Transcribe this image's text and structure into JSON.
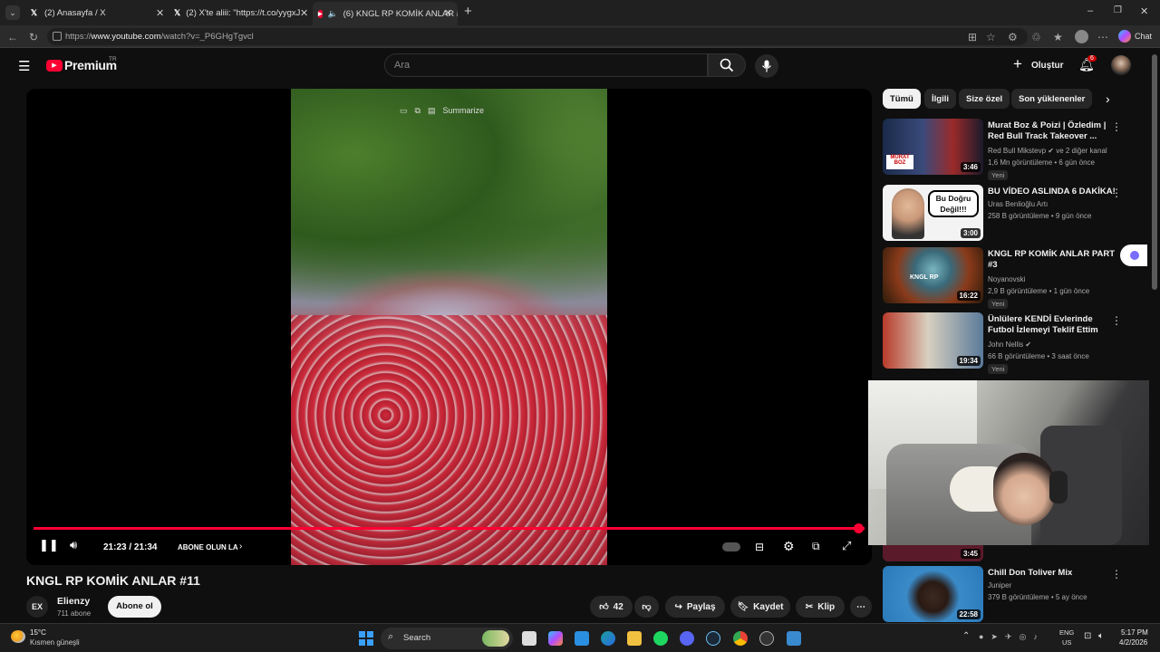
{
  "browser": {
    "tabs": [
      {
        "title": "(2) Anasayfa / X",
        "icon": "x-logo-icon"
      },
      {
        "title": "(2) X'te aliii: \"https://t.co/yygxJiKC",
        "icon": "x-logo-icon"
      },
      {
        "title": "(6) KNGL RP KOMİK ANLAR #",
        "icon": "youtube-icon"
      }
    ],
    "url_prefix": "https://",
    "url_domain": "www.youtube.com",
    "url_path": "/watch?v=_P6GHgTgvcl",
    "copilot_label": "Chat"
  },
  "youtube": {
    "logo_text": "Premium",
    "logo_region": "TR",
    "search_placeholder": "Ara",
    "create_label": "Oluştur",
    "notification_count": "6"
  },
  "player": {
    "overlay_label": "Summarize",
    "time": "21:23 / 21:34",
    "subscribe_cta": "ABONE OLUN LA",
    "progress": 1.0
  },
  "video": {
    "title": "KNGL RP KOMİK ANLAR #11",
    "channel": "Elienzy",
    "channel_avatar_text": "EX",
    "subscribers": "711 abone",
    "subscribe_button": "Abone ol",
    "likes": "42",
    "share_label": "Paylaş",
    "save_label": "Kaydet",
    "clip_label": "Klip"
  },
  "sidebar": {
    "chips": [
      "Tümü",
      "İlgili",
      "Size özel",
      "Son yüklenenler"
    ],
    "recommendations": [
      {
        "title": "Murat Boz & Poizi | Özledim | Red Bull Track Takeover ...",
        "channel": "Red Bull Mikstevp",
        "channel_extra": "ve 2 diğer kanal",
        "meta": "1,6 Mn görüntüleme • 6 gün önce",
        "badge": "Yeni",
        "duration": "3:46"
      },
      {
        "title": "BU VİDEO ASLINDA 6 DAKİKA!",
        "channel": "Uras Benlioğlu Artı",
        "meta": "258 B görüntüleme • 9 gün önce",
        "badge": "",
        "duration": "3:00",
        "thumb_text": "Bu Doğru Değil!!!"
      },
      {
        "title": "KNGL RP KOMİK ANLAR PART #3",
        "channel": "Noyanovski",
        "meta": "2,9 B görüntüleme • 1 gün önce",
        "badge": "Yeni",
        "duration": "16:22"
      },
      {
        "title": "Ünlülere KENDİ Evlerinde Futbol İzlemeyi Teklif Ettim",
        "channel": "John Nellis",
        "meta": "66 B görüntüleme • 3 saat önce",
        "badge": "Yeni",
        "duration": "19:34"
      },
      {
        "title": "Chill Don Toliver Mix",
        "channel": "Juniper",
        "meta": "379 B görüntüleme • 5 ay önce",
        "badge": "",
        "duration": "22:58"
      }
    ],
    "hidden_duration": "3:45"
  },
  "taskbar": {
    "weather_temp": "15°C",
    "weather_desc": "Kısmen güneşli",
    "search_label": "Search",
    "lang": "ENG",
    "region": "US",
    "time": "5:17 PM",
    "date": "4/2/2026"
  },
  "colors": {
    "accent": "#ff0033",
    "background": "#0f0f0f"
  }
}
